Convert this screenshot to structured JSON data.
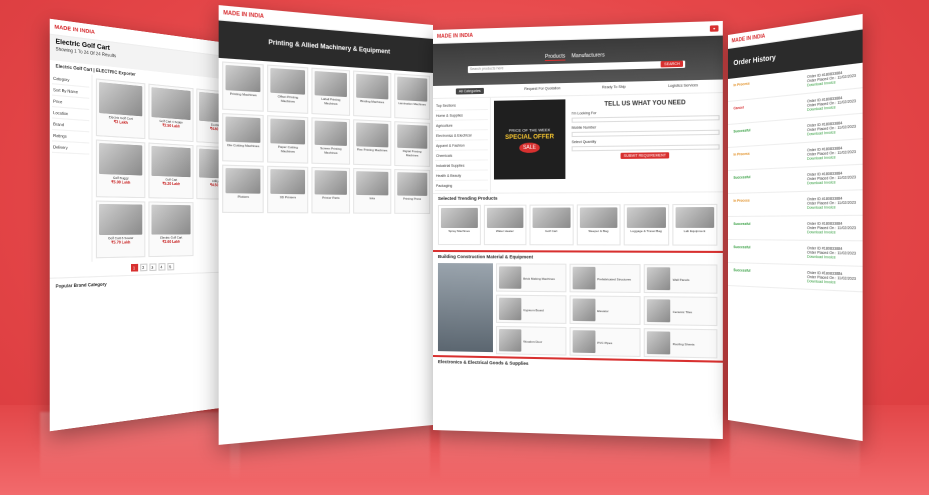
{
  "brand": "MADE IN INDIA",
  "panel1": {
    "title": "Electric Golf Cart",
    "breadcrumb": "Showing 1 To 24 Of 24 Results",
    "subtitle": "Electric Golf Cart | ELECTRIC Exporter",
    "filters": [
      "Category",
      "Sort By Name",
      "Price",
      "Location",
      "Brand",
      "Ratings",
      "Delivery"
    ],
    "products": [
      {
        "name": "Electric Golf Cart",
        "price": "₹3 Lakh"
      },
      {
        "name": "Golf Cart 4 Seater",
        "price": "₹2.50 Lakh"
      },
      {
        "name": "Electric Cart",
        "price": "₹4.80 Lakh"
      },
      {
        "name": "Golf Buggy",
        "price": "₹5.00 Lakh"
      },
      {
        "name": "Golf Cart",
        "price": "₹5.20 Lakh"
      },
      {
        "name": "Utility Cart",
        "price": "₹4.50 Lakh"
      },
      {
        "name": "Golf Cart 6 Seater",
        "price": "₹5.70 Lakh"
      },
      {
        "name": "Electric Golf Cart",
        "price": "₹2.60 Lakh"
      }
    ],
    "pages": [
      "1",
      "2",
      "3",
      "4",
      "5"
    ],
    "footer": "Popular Brand Category"
  },
  "panel2": {
    "title": "Printing & Allied Machinery & Equipment",
    "items": [
      "Printing Machines",
      "Offset Printing Machines",
      "Label Printing Machines",
      "Binding Machines",
      "Lamination Machines",
      "Die Cutting Machines",
      "Paper Cutting Machines",
      "Screen Printing Machines",
      "Flex Printing Machines",
      "Digital Printing Machines",
      "Plotters",
      "3D Printers",
      "Printer Parts",
      "Inks",
      "Printing Press"
    ]
  },
  "panel3": {
    "tabs": [
      "Products",
      "Manufacturers"
    ],
    "active_tab": "Products",
    "search_placeholder": "Search products here",
    "search_button": "SEARCH",
    "category_button": "All Categories",
    "features": [
      "Request For Quotation",
      "Ready To Ship",
      "Logistics Services"
    ],
    "sidebar": [
      "Top Sections",
      "Home & Supplies",
      "Agriculture",
      "Electronics & Electrical",
      "Apparel & Fashion",
      "Chemicals",
      "Industrial Supplies",
      "Health & Beauty",
      "Packaging"
    ],
    "banner": {
      "line1": "PRICE OF THE WEEK",
      "offer": "SPECIAL OFFER",
      "badge": "SALE"
    },
    "form": {
      "heading": "TELL US WHAT YOU NEED",
      "labels": [
        "I'm Looking For",
        "Mobile Number",
        "Select Quantity"
      ],
      "submit": "SUBMIT REQUIREMENT"
    },
    "trending_title": "Selected Trending Products",
    "trending": [
      "Spray Machines",
      "Water Heater",
      "Golf Cart",
      "Sleeper & Bag",
      "Luggage & Travel Bag",
      "Lab Equipment"
    ],
    "construction_title": "Building Construction Material & Equipment",
    "construction": [
      "Brick Making Machines",
      "Prefabricated Structures",
      "Wall Panels",
      "Gypsum Board",
      "Elevator",
      "Ceramic Tiles",
      "Wooden Door",
      "PVC Pipes",
      "Roofing Sheets"
    ],
    "electrical_title": "Electronics & Electrical Goods & Supplies"
  },
  "panel4": {
    "title": "Order History",
    "orders": [
      {
        "status": "In Process",
        "order": "Order ID #180833884",
        "date": "Order Placed On : 11/02/2023"
      },
      {
        "status": "Cancel",
        "order": "Order ID #180833884",
        "date": "Order Placed On : 11/02/2023"
      },
      {
        "status": "Successful",
        "order": "Order ID #180833884",
        "date": "Order Placed On : 11/02/2023"
      },
      {
        "status": "In Process",
        "order": "Order ID #180833884",
        "date": "Order Placed On : 11/02/2023"
      },
      {
        "status": "Successful",
        "order": "Order ID #180833884",
        "date": "Order Placed On : 11/02/2023"
      },
      {
        "status": "In Process",
        "order": "Order ID #180833884",
        "date": "Order Placed On : 11/02/2023"
      },
      {
        "status": "Successful",
        "order": "Order ID #180833884",
        "date": "Order Placed On : 11/02/2023"
      },
      {
        "status": "Successful",
        "order": "Order ID #180833884",
        "date": "Order Placed On : 11/02/2023"
      },
      {
        "status": "Successful",
        "order": "Order ID #180833884",
        "date": "Order Placed On : 11/02/2023"
      }
    ],
    "download": "Download Invoice"
  },
  "colors": {
    "background": "#e84a4c",
    "accent": "#d8302f"
  }
}
